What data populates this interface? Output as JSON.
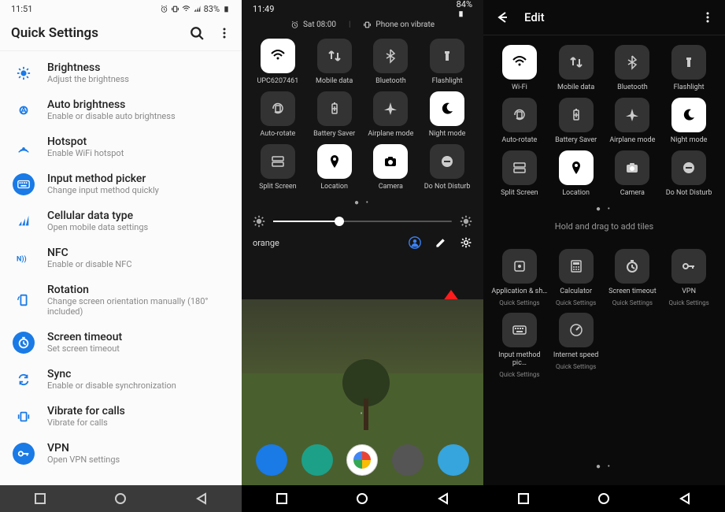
{
  "panel1": {
    "status": {
      "time": "11:51",
      "battery": "83%"
    },
    "title": "Quick Settings",
    "items": [
      {
        "icon": "brightness",
        "title": "Brightness",
        "sub": "Adjust the brightness",
        "filled": false
      },
      {
        "icon": "autobrightness",
        "title": "Auto brightness",
        "sub": "Enable or disable auto brightness",
        "filled": false
      },
      {
        "icon": "hotspot",
        "title": "Hotspot",
        "sub": "Enable WiFi hotspot",
        "filled": false
      },
      {
        "icon": "keyboard",
        "title": "Input method picker",
        "sub": "Change input method quickly",
        "filled": true
      },
      {
        "icon": "cellular",
        "title": "Cellular data type",
        "sub": "Open mobile data settings",
        "filled": false
      },
      {
        "icon": "nfc",
        "title": "NFC",
        "sub": "Enable or disable NFC",
        "filled": false
      },
      {
        "icon": "rotation",
        "title": "Rotation",
        "sub": "Change screen orientation manually (180° included)",
        "filled": false
      },
      {
        "icon": "timeout",
        "title": "Screen timeout",
        "sub": "Set screen timeout",
        "filled": true
      },
      {
        "icon": "sync",
        "title": "Sync",
        "sub": "Enable or disable synchronization",
        "filled": false
      },
      {
        "icon": "vibrate",
        "title": "Vibrate for calls",
        "sub": "Vibrate for calls",
        "filled": false
      },
      {
        "icon": "vpn",
        "title": "VPN",
        "sub": "Open VPN settings",
        "filled": true
      }
    ]
  },
  "panel2": {
    "status": {
      "time": "11:49",
      "battery": "84%"
    },
    "topline": {
      "alarm": "Sat 08:00",
      "ringer": "Phone on vibrate"
    },
    "tiles": [
      {
        "label": "UPC6207461",
        "icon": "wifi",
        "active": true
      },
      {
        "label": "Mobile data",
        "icon": "mobiledata",
        "active": false
      },
      {
        "label": "Bluetooth",
        "icon": "bluetooth",
        "active": false
      },
      {
        "label": "Flashlight",
        "icon": "flashlight",
        "active": false
      },
      {
        "label": "Auto-rotate",
        "icon": "autorotate",
        "active": false
      },
      {
        "label": "Battery Saver",
        "icon": "batterysaver",
        "active": false
      },
      {
        "label": "Airplane mode",
        "icon": "airplane",
        "active": false
      },
      {
        "label": "Night mode",
        "icon": "nightmode",
        "active": true
      },
      {
        "label": "Split Screen",
        "icon": "splitscreen",
        "active": false
      },
      {
        "label": "Location",
        "icon": "location",
        "active": true
      },
      {
        "label": "Camera",
        "icon": "camera",
        "active": true
      },
      {
        "label": "Do Not Disturb",
        "icon": "dnd",
        "active": false
      }
    ],
    "carrier": "orange"
  },
  "panel3": {
    "title": "Edit",
    "tiles_top": [
      {
        "label": "Wi-Fi",
        "icon": "wifi",
        "active": true
      },
      {
        "label": "Mobile data",
        "icon": "mobiledata",
        "active": false
      },
      {
        "label": "Bluetooth",
        "icon": "bluetooth",
        "active": false
      },
      {
        "label": "Flashlight",
        "icon": "flashlight",
        "active": false
      },
      {
        "label": "Auto-rotate",
        "icon": "autorotate",
        "active": false
      },
      {
        "label": "Battery Saver",
        "icon": "batterysaver",
        "active": false
      },
      {
        "label": "Airplane mode",
        "icon": "airplane",
        "active": false
      },
      {
        "label": "Night mode",
        "icon": "nightmode",
        "active": true
      },
      {
        "label": "Split Screen",
        "icon": "splitscreen",
        "active": false
      },
      {
        "label": "Location",
        "icon": "location",
        "active": true
      },
      {
        "label": "Camera",
        "icon": "camera",
        "active": false
      },
      {
        "label": "Do Not Disturb",
        "icon": "dnd",
        "active": false
      }
    ],
    "hint": "Hold and drag to add tiles",
    "tiles_bottom": [
      {
        "label": "Application & sh…",
        "sub": "Quick Settings",
        "icon": "app"
      },
      {
        "label": "Calculator",
        "sub": "Quick Settings",
        "icon": "calc"
      },
      {
        "label": "Screen timeout",
        "sub": "Quick Settings",
        "icon": "timeout"
      },
      {
        "label": "VPN",
        "sub": "Quick Settings",
        "icon": "vpn"
      },
      {
        "label": "Input method pic…",
        "sub": "Quick Settings",
        "icon": "keyboard"
      },
      {
        "label": "Internet speed",
        "sub": "Quick Settings",
        "icon": "speed"
      }
    ]
  }
}
